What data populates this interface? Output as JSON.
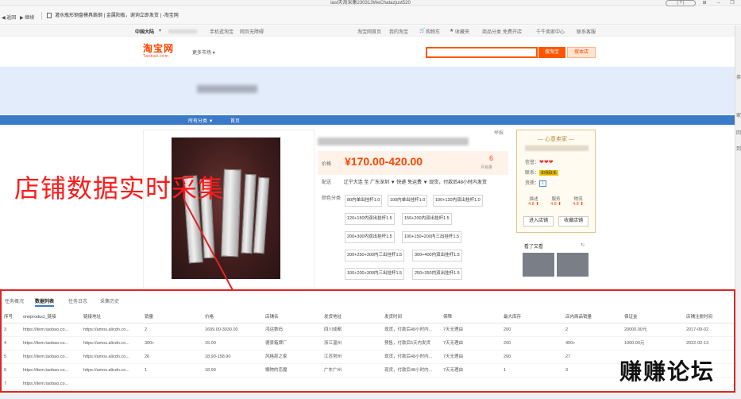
{
  "window": {
    "title": "last天淘采集230313WeChatazjust520",
    "help": "(   ?   )"
  },
  "toolbar": {
    "back": "返回",
    "forward": "继续",
    "url": "灌水瓶形钢盘模具鎢钢 | 金属阳板，谢询立即发货 | -淘宝网"
  },
  "sitenav": {
    "region": "中国大陆",
    "mobile": "手机逛淘宝",
    "accessibility": "网页无障碍",
    "home": "淘宝网首页",
    "my": "我的淘宝",
    "cart": "购物车",
    "fav": "收藏夹",
    "category": "商品分类",
    "free": "免费开店",
    "seller": "千牛卖家中心",
    "service": "联系客服"
  },
  "header": {
    "logo_cn": "淘宝网",
    "logo_en": "Taobao.com",
    "market": "更多市场",
    "search_btn": "搜淘宝",
    "store_btn": "搜本店"
  },
  "shopnav": {
    "all": "所有分类 ▼",
    "home": "首页"
  },
  "scroll_strip": {
    "t1": "卖",
    "t2": "家",
    "t3": "回",
    "t4": "到"
  },
  "product": {
    "report": "举报",
    "price_label": "价格",
    "price": "¥170.00-420.00",
    "sold_count": "6",
    "sold_label": "月销量",
    "ship_label": "配送",
    "ship_value": "辽宁大连 至 广东深圳 ▼  快递 免运费 ▼  现货，付款后48小时内发货",
    "color_label": "颜色分类",
    "options": [
      "80内单出挂杆1.0",
      "100内单出挂杆1.0",
      "100+120内双出挂杆1.0",
      "120+150内双出挂杆1.5",
      "150+200内双出挂杆1.5",
      "200+300内双出挂杆1.5",
      "100+150+200内三出挂杆1.5",
      "200+250+300内三出挂杆1.5",
      "300+400内双出挂杆1.5",
      "100+200+300内三出挂杆1.5",
      "250+350内双出挂杆1.5"
    ]
  },
  "seller": {
    "title": "心意卖家",
    "credit_label": "信誉：",
    "contact_label": "联系：",
    "contact_badge": "和我联系",
    "quality_label": "资质：",
    "quality_num": "1",
    "m1": "描述",
    "m1v": "4.8 ⬆",
    "m2": "服务",
    "m2v": "4.8 ⬆",
    "m3": "物流",
    "m3v": "4.8 ⬆",
    "btn_enter": "进入店铺",
    "btn_fav": "收藏店铺",
    "seen": "看了又看"
  },
  "overlay": {
    "caption": "店铺数据实时采集",
    "watermark": "赚赚论坛"
  },
  "panel": {
    "tabs": [
      "任务概况",
      "数据列表",
      "任务日志",
      "采集历史"
    ],
    "active_tab": 1,
    "columns": [
      "序号",
      "oneproduct_链接",
      "链接地址",
      "销量",
      "价格",
      "店铺名",
      "发货地址",
      "发货时间",
      "保障",
      "最大库存",
      "店内商品销量",
      "保证金",
      "店铺注册时间"
    ],
    "rows": [
      [
        "3",
        "https://item.taobao.co...",
        "https://amos.alicdn.co...",
        "2",
        "1699.00-3030.00",
        "鸿运数码",
        "四川成都",
        "现货，付款后48小时内...",
        "7天无理由",
        "200",
        "2",
        "20000.00元",
        "2017-09-02"
      ],
      [
        "4",
        "https://item.taobao.co...",
        "https://amos.alicdn.co...",
        "300+",
        "15.00",
        "德豪箱牌厂",
        "浙江温州",
        "预售，付款后5天内发货",
        "7天无理由",
        "200",
        "400+",
        "1000.00元",
        "2022-02-13"
      ],
      [
        "5",
        "https://item.taobao.co...",
        "https://amos.alicdn.co...",
        "26",
        "18.90-158.90",
        "风格部之家",
        "江苏常州",
        "现货，付款后48小时内...",
        "7天无理由",
        "200",
        "27",
        "",
        ""
      ],
      [
        "6",
        "https://item.taobao.co...",
        "https://amos.alicdn.co...",
        "1",
        "18.99",
        "懒物的恋魔",
        "广东广州",
        "现货，付款后48小时内...",
        "7天无理由",
        "1",
        "3",
        "",
        ""
      ],
      [
        "7",
        "https://item.taobao.co...",
        "",
        "",
        "",
        "",
        "",
        "",
        "",
        "",
        "",
        "",
        ""
      ]
    ]
  }
}
